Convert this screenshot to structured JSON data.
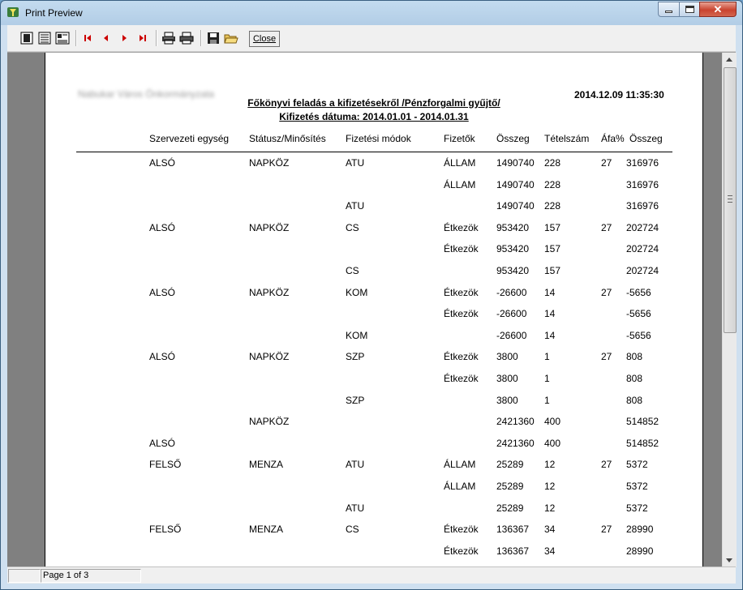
{
  "window": {
    "title": "Print Preview",
    "colors": {
      "titlebar": "#b9d1ea",
      "close": "#c9432f"
    }
  },
  "toolbar": {
    "icons": [
      "one-page-icon",
      "two-page-icon",
      "multi-page-icon",
      "first-page-icon",
      "prev-page-icon",
      "next-page-icon",
      "last-page-icon",
      "print-setup-icon",
      "print-icon",
      "save-icon",
      "open-icon"
    ],
    "close_label": "Close"
  },
  "report": {
    "company": "Nabukar Város Önkormányzata",
    "timestamp": "2014.12.09 11:35:30",
    "title": "Főkönyvi feladás a kifizetésekről /Pénzforgalmi gyűjtő/",
    "subtitle": "Kifizetés dátuma: 2014.01.01 - 2014.01.31",
    "columns": [
      "Szervezeti egység",
      "Státusz/Minősítés",
      "Fizetési módok",
      "Fizetők",
      "Összeg",
      "Tételszám",
      "Áfa%",
      "Összeg"
    ],
    "rows": [
      [
        "ALSÓ",
        "NAPKÖZ",
        "ATU",
        "ÁLLAM",
        "1490740",
        "228",
        "27",
        "316976"
      ],
      [
        "",
        "",
        "",
        "ÁLLAM",
        "1490740",
        "228",
        "",
        "316976"
      ],
      [
        "",
        "",
        "ATU",
        "",
        "1490740",
        "228",
        "",
        "316976"
      ],
      [
        "ALSÓ",
        "NAPKÖZ",
        "CS",
        "Étkezök",
        "953420",
        "157",
        "27",
        "202724"
      ],
      [
        "",
        "",
        "",
        "Étkezök",
        "953420",
        "157",
        "",
        "202724"
      ],
      [
        "",
        "",
        "CS",
        "",
        "953420",
        "157",
        "",
        "202724"
      ],
      [
        "ALSÓ",
        "NAPKÖZ",
        "KOM",
        "Étkezök",
        "-26600",
        "14",
        "27",
        "-5656"
      ],
      [
        "",
        "",
        "",
        "Étkezök",
        "-26600",
        "14",
        "",
        "-5656"
      ],
      [
        "",
        "",
        "KOM",
        "",
        "-26600",
        "14",
        "",
        "-5656"
      ],
      [
        "ALSÓ",
        "NAPKÖZ",
        "SZP",
        "Étkezök",
        "3800",
        "1",
        "27",
        "808"
      ],
      [
        "",
        "",
        "",
        "Étkezök",
        "3800",
        "1",
        "",
        "808"
      ],
      [
        "",
        "",
        "SZP",
        "",
        "3800",
        "1",
        "",
        "808"
      ],
      [
        "",
        "NAPKÖZ",
        "",
        "",
        "2421360",
        "400",
        "",
        "514852"
      ],
      [
        "ALSÓ",
        "",
        "",
        "",
        "2421360",
        "400",
        "",
        "514852"
      ],
      [
        "FELSŐ",
        "MENZA",
        "ATU",
        "ÁLLAM",
        "25289",
        "12",
        "27",
        "5372"
      ],
      [
        "",
        "",
        "",
        "ÁLLAM",
        "25289",
        "12",
        "",
        "5372"
      ],
      [
        "",
        "",
        "ATU",
        "",
        "25289",
        "12",
        "",
        "5372"
      ],
      [
        "FELSŐ",
        "MENZA",
        "CS",
        "Étkezök",
        "136367",
        "34",
        "27",
        "28990"
      ],
      [
        "",
        "",
        "",
        "Étkezök",
        "136367",
        "34",
        "",
        "28990"
      ]
    ]
  },
  "status": {
    "page": "Page 1 of 3"
  }
}
